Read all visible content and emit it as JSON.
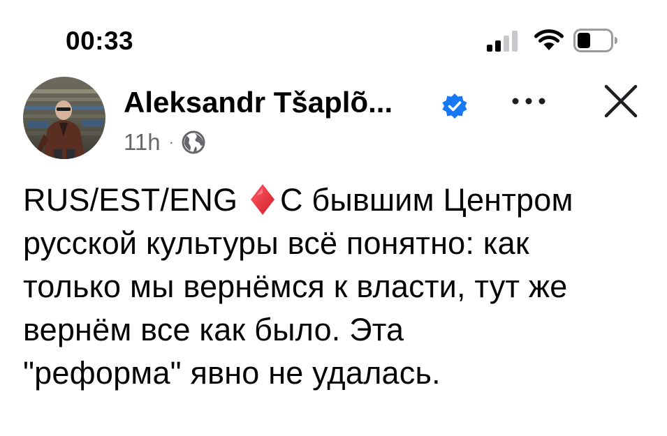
{
  "status_bar": {
    "time": "00:33",
    "signal_bars": 2,
    "battery_level": 0.35
  },
  "post": {
    "author": {
      "name": "Aleksandr Tšaplõ...",
      "verified": true
    },
    "timestamp": "11h",
    "separator": "·",
    "visibility_icon": "globe-icon",
    "body": {
      "line1_prefix": "RUS/EST/ENG",
      "line1_emoji": "red-diamond-icon",
      "line1_suffix": "С бывшим Центром",
      "line2": "русской культуры всё понятно: как",
      "line3": "только мы вернёмся к власти, тут же",
      "line4": "вернём все как было. Эта",
      "line5": "\"реформа\" явно не удалась."
    }
  },
  "colors": {
    "verified_badge": "#1877f2",
    "meta_text": "#65676b",
    "diamond": "#e8303a"
  }
}
